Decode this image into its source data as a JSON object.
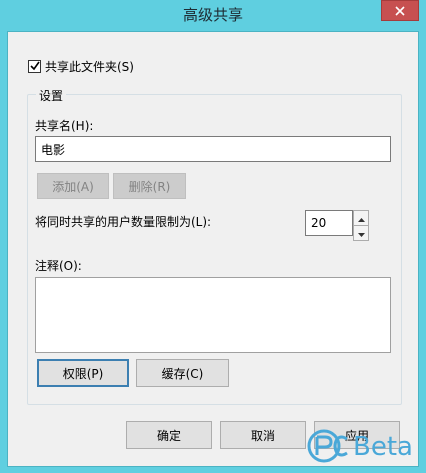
{
  "window": {
    "title": "高级共享"
  },
  "share_checkbox": {
    "label": "共享此文件夹(S)",
    "checked": true
  },
  "settings_group": {
    "legend": "设置",
    "share_name_label": "共享名(H):",
    "share_name_value": "电影",
    "add_button": "添加(A)",
    "remove_button": "删除(R)",
    "user_limit_label": "将同时共享的用户数量限制为(L):",
    "user_limit_value": "20",
    "comment_label": "注释(O):",
    "comment_value": "",
    "permissions_button": "权限(P)",
    "caching_button": "缓存(C)"
  },
  "footer": {
    "ok_button": "确定",
    "cancel_button": "取消",
    "apply_button": "应用"
  },
  "watermark": {
    "text": "Beta"
  },
  "colors": {
    "titlebar": "#5fcfe0",
    "close": "#c75050",
    "dialog_bg": "#f0f0f0",
    "focus_border": "#3c7fb1",
    "watermark": "#4aa8d8"
  },
  "icons": {
    "close": "close-icon",
    "check": "checkmark-icon",
    "spin_up": "chevron-up-icon",
    "spin_down": "chevron-down-icon",
    "logo": "pcbeta-logo-icon"
  }
}
